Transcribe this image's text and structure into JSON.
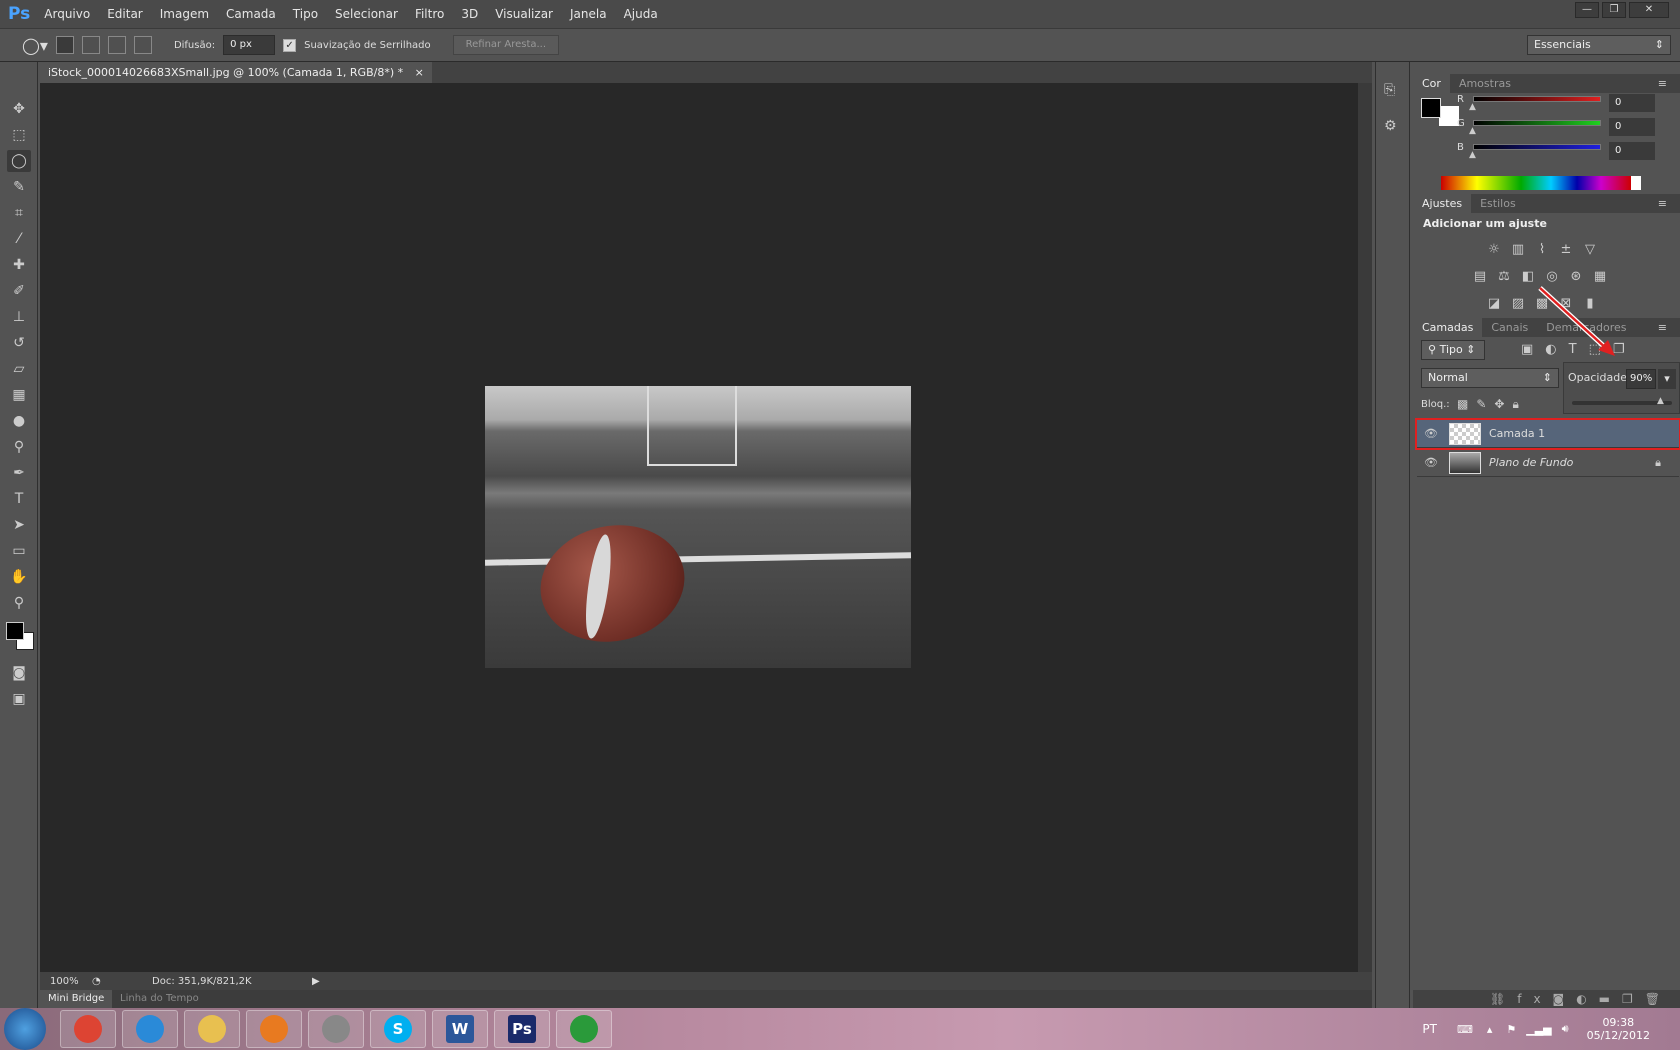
{
  "app": {
    "logo": "Ps",
    "menu": [
      "Arquivo",
      "Editar",
      "Imagem",
      "Camada",
      "Tipo",
      "Selecionar",
      "Filtro",
      "3D",
      "Visualizar",
      "Janela",
      "Ajuda"
    ],
    "window_buttons": [
      "—",
      "❐",
      "✕"
    ]
  },
  "options": {
    "feather_label": "Difusão:",
    "feather_value": "0 px",
    "antialias_label": "Suavização de Serrilhado",
    "antialias_checked": true,
    "refine_label": "Refinar Aresta...",
    "workspace": "Essenciais"
  },
  "document": {
    "tab_title": "iStock_000014026683XSmall.jpg @ 100% (Camada 1, RGB/8*) *",
    "close": "×",
    "zoom": "100%",
    "doc_info": "Doc: 351,9K/821,2K"
  },
  "bottom_tabs": [
    "Mini Bridge",
    "Linha do Tempo"
  ],
  "color_panel": {
    "tabs": [
      "Cor",
      "Amostras"
    ],
    "channels": [
      {
        "label": "R",
        "value": "0",
        "color": "#e02020"
      },
      {
        "label": "G",
        "value": "0",
        "color": "#20d020"
      },
      {
        "label": "B",
        "value": "0",
        "color": "#2020e0"
      }
    ],
    "foreground": "#000000",
    "background": "#ffffff"
  },
  "adjust_panel": {
    "tabs": [
      "Ajustes",
      "Estilos"
    ],
    "heading": "Adicionar um ajuste"
  },
  "layers_panel": {
    "tabs": [
      "Camadas",
      "Canais",
      "Demarcadores"
    ],
    "filter": "Tipo",
    "blend_mode": "Normal",
    "opacity_label": "Opacidade:",
    "opacity_value": "90%",
    "opacity_percent": 90,
    "lock_label": "Bloq.:",
    "layers": [
      {
        "name": "Camada 1",
        "selected": true,
        "locked": false
      },
      {
        "name": "Plano de Fundo",
        "selected": false,
        "locked": true
      }
    ]
  },
  "annotation_color": "#e02020",
  "taskbar": {
    "apps": [
      "chrome",
      "internet-explorer",
      "explorer",
      "media-player",
      "app",
      "skype",
      "word",
      "photoshop",
      "spotify"
    ],
    "app_labels": {
      "skype": "S",
      "word": "W",
      "photoshop": "Ps"
    },
    "lang": "PT",
    "time": "09:38",
    "date": "05/12/2012"
  }
}
